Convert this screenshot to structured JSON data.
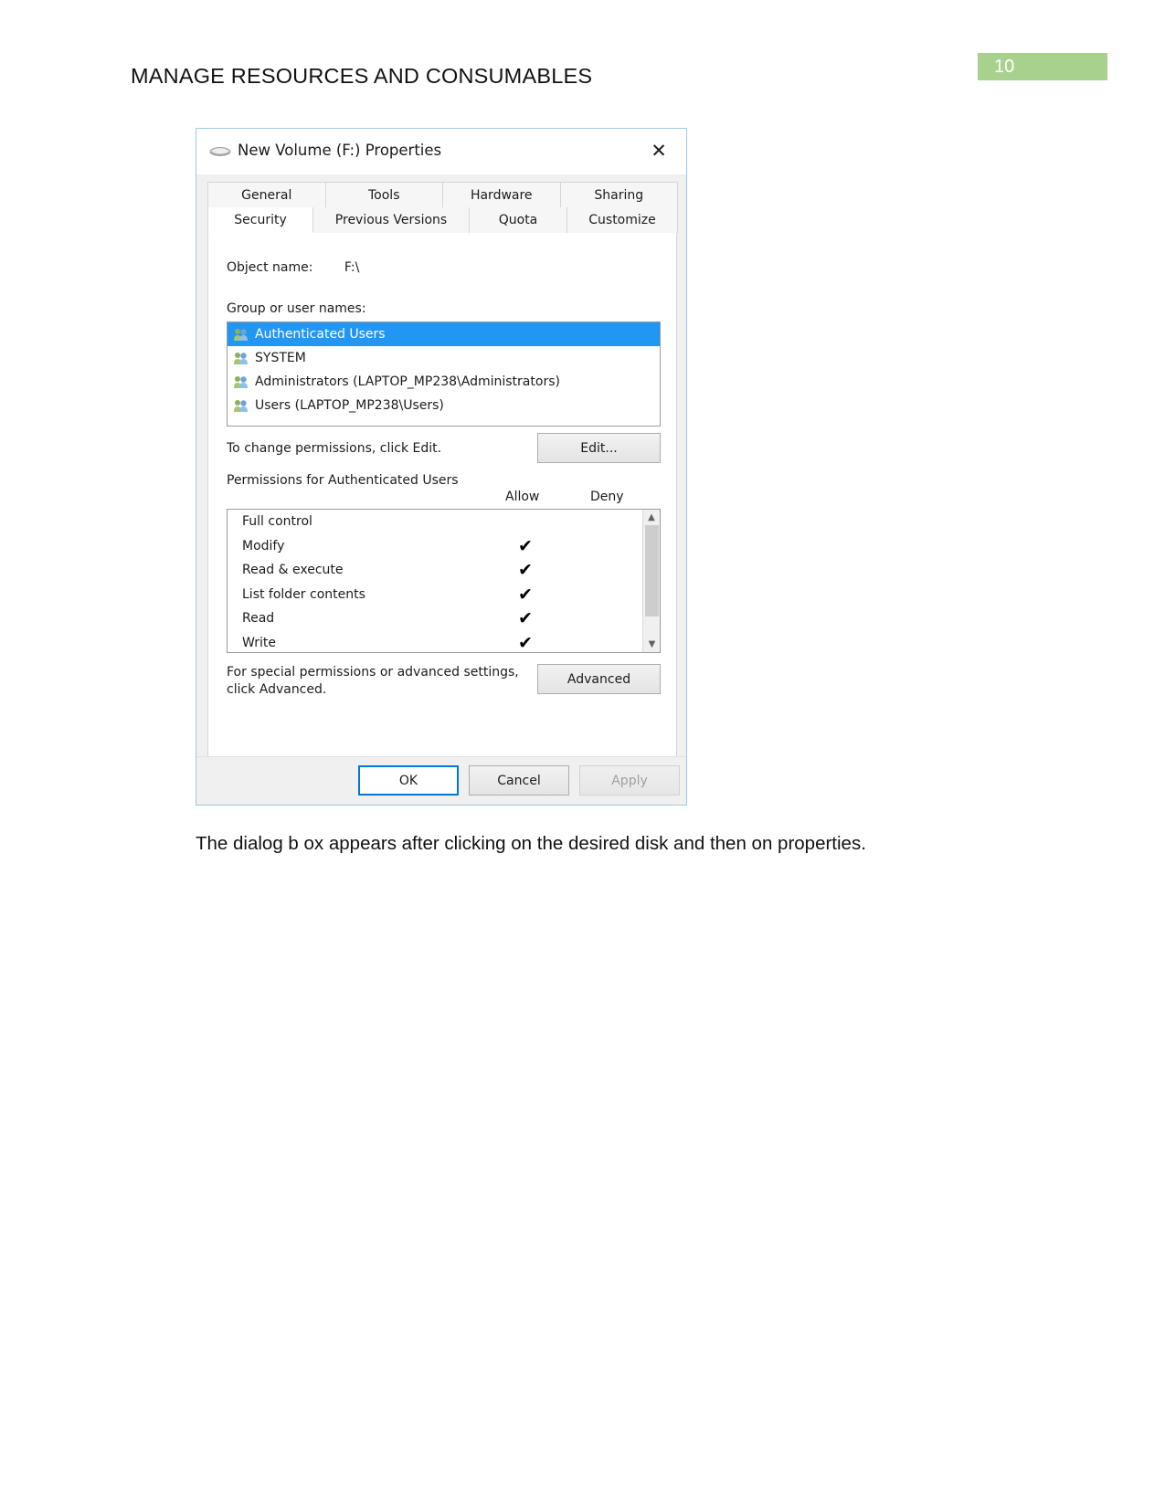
{
  "page": {
    "heading": "MANAGE RESOURCES AND CONSUMABLES",
    "page_number": "10",
    "badge_color": "#a9d18e",
    "caption": "The dialog b ox appears after clicking on the desired disk and then on properties."
  },
  "dialog": {
    "title": "New Volume (F:) Properties",
    "title_icon": "disk-drive-icon",
    "close_label": "✕",
    "tabs_row1": [
      {
        "label": "General",
        "active": false
      },
      {
        "label": "Tools",
        "active": false
      },
      {
        "label": "Hardware",
        "active": false
      },
      {
        "label": "Sharing",
        "active": false
      }
    ],
    "tabs_row2": [
      {
        "label": "Security",
        "active": true
      },
      {
        "label": "Previous Versions",
        "active": false
      },
      {
        "label": "Quota",
        "active": false
      },
      {
        "label": "Customize",
        "active": false
      }
    ],
    "object_name_label": "Object name:",
    "object_name_value": "F:\\",
    "group_label": "Group or user names:",
    "users": [
      {
        "name": "Authenticated Users",
        "selected": true
      },
      {
        "name": "SYSTEM",
        "selected": false
      },
      {
        "name": "Administrators (LAPTOP_MP238\\Administrators)",
        "selected": false
      },
      {
        "name": "Users (LAPTOP_MP238\\Users)",
        "selected": false
      }
    ],
    "edit_hint": "To change permissions, click Edit.",
    "edit_button": "Edit...",
    "permissions_header": "Permissions for Authenticated Users",
    "column_allow": "Allow",
    "column_deny": "Deny",
    "permissions": [
      {
        "name": "Full control",
        "allow": "",
        "deny": ""
      },
      {
        "name": "Modify",
        "allow": "✔",
        "deny": ""
      },
      {
        "name": "Read & execute",
        "allow": "✔",
        "deny": ""
      },
      {
        "name": "List folder contents",
        "allow": "✔",
        "deny": ""
      },
      {
        "name": "Read",
        "allow": "✔",
        "deny": ""
      },
      {
        "name": "Write",
        "allow": "✔",
        "deny": ""
      }
    ],
    "advanced_hint": "For special permissions or advanced settings, click Advanced.",
    "advanced_button": "Advanced",
    "ok_button": "OK",
    "cancel_button": "Cancel",
    "apply_button": "Apply",
    "accent_color": "#0078d7",
    "selection_color": "#2196f3"
  }
}
